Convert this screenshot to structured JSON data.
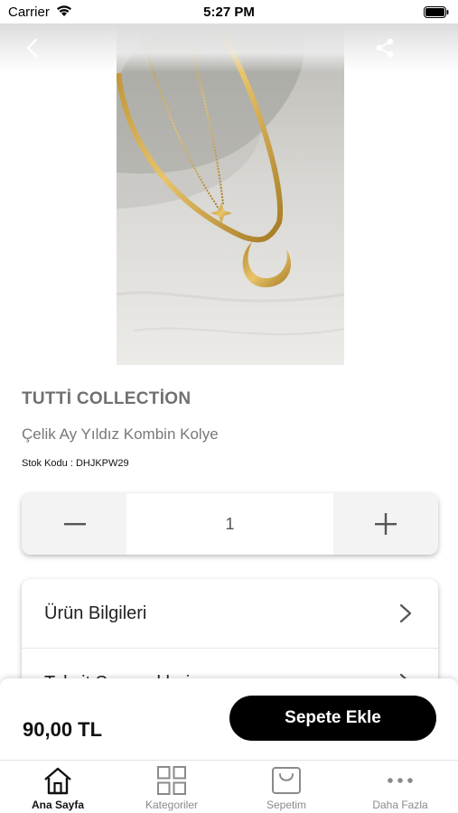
{
  "status_bar": {
    "carrier": "Carrier",
    "time": "5:27 PM"
  },
  "product": {
    "brand": "TUTTİ COLLECTİON",
    "name": "Çelik Ay Yıldız Kombin Kolye",
    "stock_label": "Stok Kodu :",
    "stock_code": "DHJKPW29",
    "quantity": "1",
    "price": "90,00 TL",
    "image_icon": "gold-necklace-photo"
  },
  "accordion": {
    "items": [
      {
        "label": "Ürün Bilgileri"
      },
      {
        "label": "Taksit Seçenekleri"
      }
    ]
  },
  "actions": {
    "add_to_cart": "Sepete Ekle"
  },
  "tab_bar": {
    "tabs": [
      {
        "label": "Ana Sayfa",
        "icon": "home-icon",
        "active": true
      },
      {
        "label": "Kategoriler",
        "icon": "grid-icon",
        "active": false
      },
      {
        "label": "Sepetim",
        "icon": "cart-icon",
        "active": false
      },
      {
        "label": "Daha Fazla",
        "icon": "more-icon",
        "active": false
      }
    ]
  },
  "colors": {
    "button_bg": "#000000",
    "muted_text": "#787878",
    "active_tab": "#111111",
    "inactive_tab": "#8a8a8a"
  }
}
